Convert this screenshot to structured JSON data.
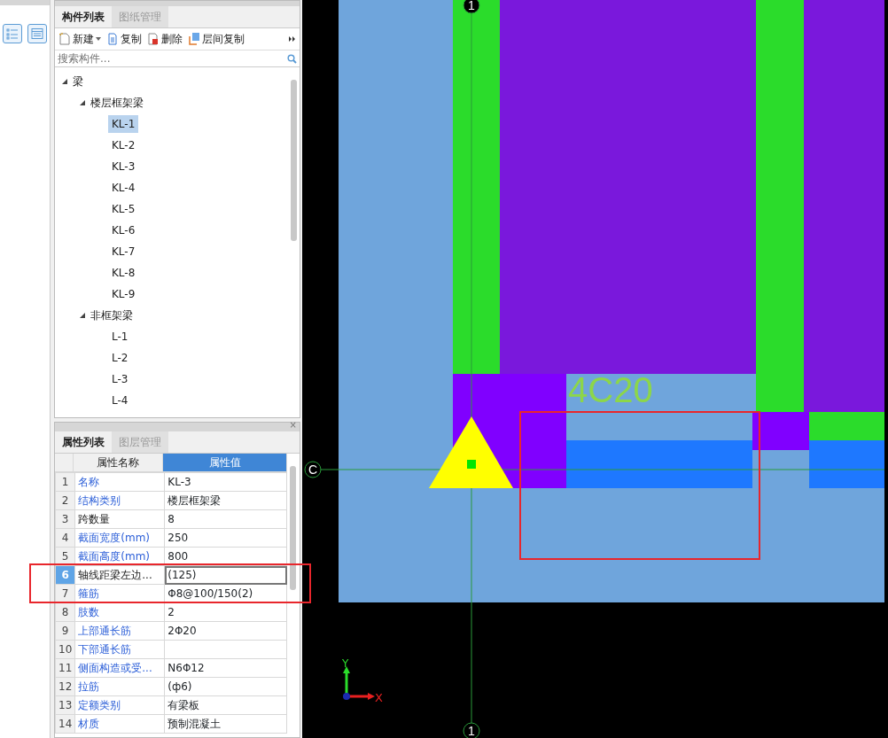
{
  "component_panel": {
    "tabs": [
      {
        "label": "构件列表",
        "selected": true
      },
      {
        "label": "图纸管理",
        "selected": false
      }
    ],
    "toolbar": [
      {
        "label": "新建",
        "dropdown": true
      },
      {
        "label": "复制",
        "dropdown": false
      },
      {
        "label": "删除",
        "dropdown": false
      },
      {
        "label": "层间复制",
        "dropdown": false
      }
    ],
    "search": {
      "placeholder": "搜索构件..."
    },
    "tree": [
      {
        "label": "梁",
        "expanded": true,
        "selected": false,
        "children": [
          {
            "label": "楼层框架梁",
            "expanded": true,
            "selected": false,
            "children": [
              {
                "label": "KL-1",
                "selected": true
              },
              {
                "label": "KL-2",
                "selected": false
              },
              {
                "label": "KL-3",
                "selected": false
              },
              {
                "label": "KL-4",
                "selected": false
              },
              {
                "label": "KL-5",
                "selected": false
              },
              {
                "label": "KL-6",
                "selected": false
              },
              {
                "label": "KL-7",
                "selected": false
              },
              {
                "label": "KL-8",
                "selected": false
              },
              {
                "label": "KL-9",
                "selected": false
              }
            ]
          },
          {
            "label": "非框架梁",
            "expanded": true,
            "selected": false,
            "children": [
              {
                "label": "L-1",
                "selected": false
              },
              {
                "label": "L-2",
                "selected": false
              },
              {
                "label": "L-3",
                "selected": false
              },
              {
                "label": "L-4",
                "selected": false
              }
            ]
          }
        ]
      }
    ]
  },
  "properties_panel": {
    "close": "×",
    "tabs": [
      {
        "label": "属性列表",
        "selected": true
      },
      {
        "label": "图层管理",
        "selected": false
      }
    ],
    "columns": [
      "属性名称",
      "属性值"
    ],
    "rows": [
      {
        "number": "1",
        "name": "名称",
        "value": "KL-3",
        "common": true,
        "selected": false
      },
      {
        "number": "2",
        "name": "结构类别",
        "value": "楼层框架梁",
        "common": true,
        "selected": false
      },
      {
        "number": "3",
        "name": "跨数量",
        "value": "8",
        "common": false,
        "selected": false
      },
      {
        "number": "4",
        "name": "截面宽度(mm)",
        "value": "250",
        "common": true,
        "selected": false
      },
      {
        "number": "5",
        "name": "截面高度(mm)",
        "value": "800",
        "common": true,
        "selected": false
      },
      {
        "number": "6",
        "name": "轴线距梁左边...",
        "value": "(125)",
        "common": false,
        "selected": true
      },
      {
        "number": "7",
        "name": "箍筋",
        "value": "Φ8@100/150(2)",
        "common": true,
        "selected": false
      },
      {
        "number": "8",
        "name": "肢数",
        "value": "2",
        "common": true,
        "selected": false
      },
      {
        "number": "9",
        "name": "上部通长筋",
        "value": "2Φ20",
        "common": true,
        "selected": false
      },
      {
        "number": "10",
        "name": "下部通长筋",
        "value": "",
        "common": true,
        "selected": false
      },
      {
        "number": "11",
        "name": "侧面构造或受...",
        "value": "N6Φ12",
        "common": true,
        "selected": false
      },
      {
        "number": "12",
        "name": "拉筋",
        "value": "(ф6)",
        "common": true,
        "selected": false
      },
      {
        "number": "13",
        "name": "定额类别",
        "value": "有梁板",
        "common": true,
        "selected": false
      },
      {
        "number": "14",
        "name": "材质",
        "value": "预制混凝土",
        "common": true,
        "selected": false
      }
    ]
  },
  "canvas": {
    "rebar_label": "4C20",
    "axis_markers": [
      {
        "label": "1"
      },
      {
        "label": "C"
      },
      {
        "label": "1"
      }
    ],
    "axes": {
      "x": "X",
      "y": "Y"
    }
  }
}
